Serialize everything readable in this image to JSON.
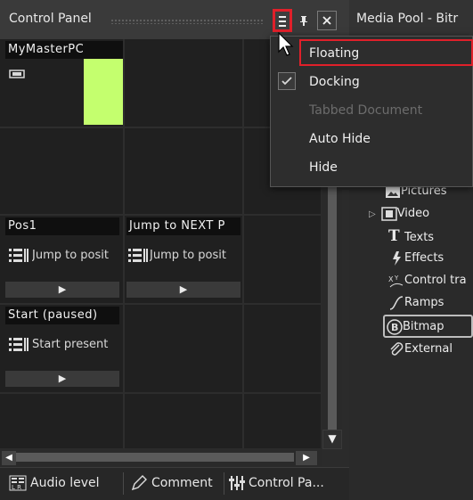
{
  "control_panel": {
    "title": "Control Panel",
    "menu_icon": "hamburger-icon",
    "pin_icon": "pin-icon",
    "close_icon": "close-icon"
  },
  "cells": {
    "master_pc": {
      "label": "MyMasterPC",
      "tile_color": "#c4ff6e"
    },
    "pos1": {
      "label": "Pos1",
      "action": "Jump to posit"
    },
    "jump_next": {
      "label": "Jump to NEXT P",
      "action": "Jump to posit"
    },
    "start": {
      "label": "Start  (paused)",
      "action": "Start present"
    },
    "play_symbol": "▶"
  },
  "scroll": {
    "down_arrow": "▼",
    "left_arrow": "◀",
    "right_arrow": "▶"
  },
  "bottom_tabs": [
    {
      "label": "Audio level",
      "icon": "audio-level-icon"
    },
    {
      "label": "Comment",
      "icon": "pencil-icon"
    },
    {
      "label": "Control Pa...",
      "icon": "control-panel-icon"
    }
  ],
  "media_pool": {
    "title": "Media Pool - Bitr",
    "items": [
      {
        "label": "Pictures",
        "icon": "pictures-icon"
      },
      {
        "label": "Video",
        "icon": "video-icon",
        "expand": "▷"
      },
      {
        "label": "Texts",
        "icon": "text-icon"
      },
      {
        "label": "Effects",
        "icon": "effects-icon"
      },
      {
        "label": "Control tra",
        "icon": "control-track-icon"
      },
      {
        "label": "Ramps",
        "icon": "ramps-icon"
      },
      {
        "label": "Bitmap",
        "icon": "bitmap-icon"
      },
      {
        "label": "External",
        "icon": "paperclip-icon"
      }
    ]
  },
  "menu": {
    "items": [
      {
        "label": "Floating"
      },
      {
        "label": "Docking",
        "checked": true
      },
      {
        "label": "Tabbed Document",
        "disabled": true
      },
      {
        "label": "Auto Hide"
      },
      {
        "label": "Hide"
      }
    ]
  },
  "colors": {
    "highlight": "#e0202a",
    "accent_green": "#c4ff6e"
  }
}
